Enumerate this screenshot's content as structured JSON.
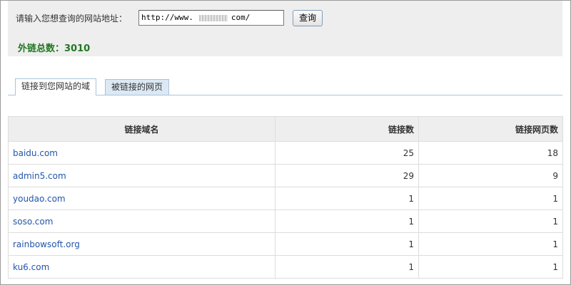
{
  "query": {
    "label": "请输入您想查询的网站地址：",
    "url_value": "http://www.        com/",
    "button_label": "查询"
  },
  "total": "外链总数：3010",
  "tabs": [
    {
      "label": "链接到您网站的域",
      "active": true
    },
    {
      "label": "被链接的网页",
      "active": false
    }
  ],
  "table": {
    "headers": [
      "链接域名",
      "链接数",
      "链接网页数"
    ],
    "rows": [
      {
        "domain": "baidu.com",
        "links": "25",
        "pages": "18"
      },
      {
        "domain": "admin5.com",
        "links": "29",
        "pages": "9"
      },
      {
        "domain": "youdao.com",
        "links": "1",
        "pages": "1"
      },
      {
        "domain": "soso.com",
        "links": "1",
        "pages": "1"
      },
      {
        "domain": "rainbowsoft.org",
        "links": "1",
        "pages": "1"
      },
      {
        "domain": "ku6.com",
        "links": "1",
        "pages": "1"
      }
    ]
  },
  "colors": {
    "total_text": "#227722",
    "link": "#2255aa",
    "panel_bg": "#eeeeee",
    "tab_border": "#a9c3db"
  }
}
